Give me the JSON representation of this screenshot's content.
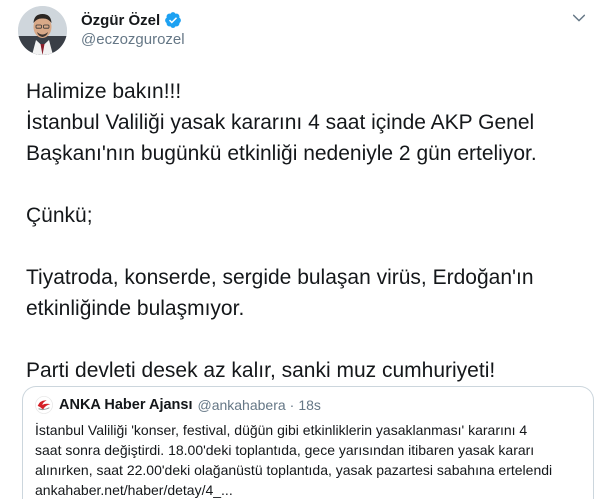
{
  "tweet": {
    "author": {
      "display_name": "Özgür Özel",
      "handle": "@eczozgurozel",
      "verified": true
    },
    "text_lines": [
      "Halimize bakın!!!",
      "İstanbul Valiliği yasak kararını 4 saat içinde AKP Genel",
      "Başkanı'nın bugünkü etkinliği nedeniyle 2 gün erteliyor.",
      "",
      "Çünkü;",
      "",
      "Tiyatroda, konserde, sergide bulaşan virüs, Erdoğan'ın",
      "etkinliğinde bulaşmıyor.",
      "",
      "Parti devleti desek az kalır, sanki muz cumhuriyeti!"
    ]
  },
  "quoted_tweet": {
    "display_name": "ANKA Haber Ajansı",
    "handle": "@ankahabera",
    "separator": "·",
    "time": "18s",
    "text_lines": [
      "İstanbul Valiliği 'konser, festival, düğün gibi etkinliklerin yasaklanması' kararını 4",
      "saat sonra değiştirdi. 18.00'deki toplantıda, gece yarısından itibaren yasak kararı",
      "alınırken, saat 22.00'deki olağanüstü toplantıda, yasak pazartesi sabahına ertelendi",
      "ankahaber.net/haber/detay/4_..."
    ]
  },
  "icons": {
    "verified": "verified-badge-icon",
    "more": "chevron-down-icon",
    "quoted_logo": "anka-logo-icon"
  },
  "colors": {
    "text": "#14171a",
    "secondary": "#657786",
    "verified": "#1da1f2",
    "border": "#ccd6dd"
  }
}
